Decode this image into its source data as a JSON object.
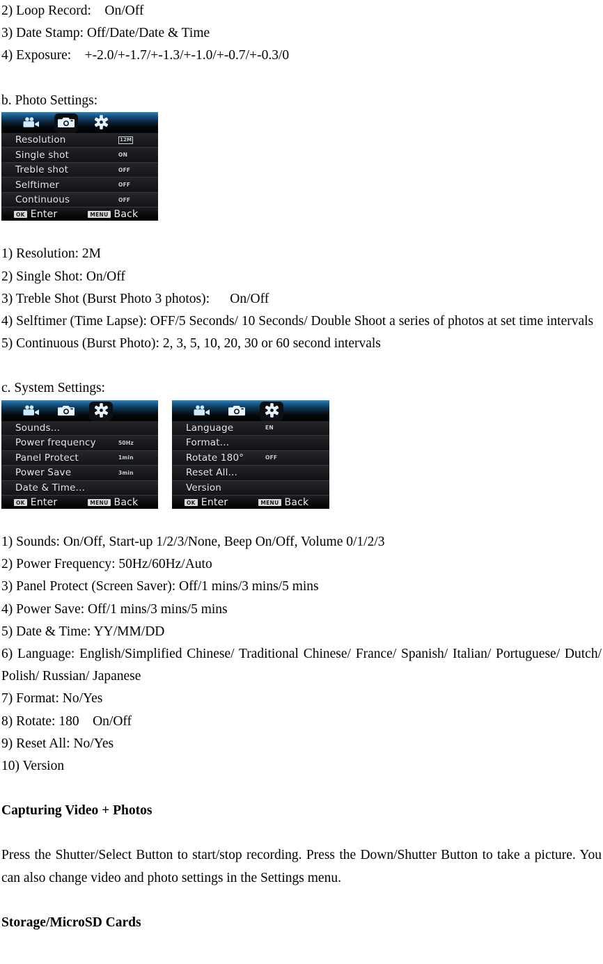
{
  "document": {
    "top_lines": [
      "2) Loop Record:    On/Off",
      "3) Date Stamp: Off/Date/Date & Time",
      "4) Exposure:    +-2.0/+-1.7/+-1.3/+-1.0/+-0.7/+-0.3/0"
    ],
    "photo_settings_heading": "b. Photo Settings:",
    "photo_settings_lines": [
      "1) Resolution: 2M",
      "2) Single Shot: On/Off",
      "3) Treble Shot (Burst Photo 3 photos):      On/Off",
      "4) Selftimer (Time Lapse): OFF/5 Seconds/ 10 Seconds/ Double Shoot a series of photos at set time intervals",
      "5) Continuous (Burst Photo): 2, 3, 5, 10, 20, 30 or 60 second intervals"
    ],
    "system_settings_heading": "c. System Settings:",
    "system_settings_lines": [
      "1) Sounds: On/Off, Start-up 1/2/3/None, Beep On/Off, Volume 0/1/2/3",
      "2) Power Frequency: 50Hz/60Hz/Auto",
      "3) Panel Protect (Screen Saver): Off/1 mins/3 mins/5 mins",
      "4) Power Save: Off/1 mins/3 mins/5 mins",
      "5) Date & Time: YY/MM/DD",
      "6) Language: English/Simplified Chinese/ Traditional Chinese/ France/ Spanish/ Italian/ Portuguese/ Dutch/ Polish/ Russian/ Japanese",
      "7) Format: No/Yes",
      "8) Rotate: 180    On/Off",
      "9) Reset All: No/Yes",
      "10) Version"
    ],
    "capturing_heading": "Capturing Video + Photos",
    "capturing_body": "Press the Shutter/Select Button to start/stop recording. Press the Down/Shutter Button to take a picture. You can also change video and photo settings in the Settings menu.",
    "storage_heading": "Storage/MicroSD Cards"
  },
  "osd_screens": {
    "photo": {
      "tabs": [
        {
          "icon": "video-camera-icon",
          "active": false
        },
        {
          "icon": "photo-camera-icon",
          "active": true
        },
        {
          "icon": "gear-icon",
          "active": false
        }
      ],
      "rows": [
        {
          "label": "Resolution",
          "value": "12M",
          "boxed": true
        },
        {
          "label": "Single shot",
          "value": "ON",
          "boxed": false
        },
        {
          "label": "Treble shot",
          "value": "OFF",
          "boxed": false
        },
        {
          "label": "Selftimer",
          "value": "OFF",
          "boxed": false
        },
        {
          "label": "Continuous",
          "value": "OFF",
          "boxed": false
        }
      ],
      "footer": {
        "ok_key": "OK",
        "ok_label": "Enter",
        "menu_key": "MENU",
        "menu_label": "Back"
      }
    },
    "system_a": {
      "tabs": [
        {
          "icon": "video-camera-icon",
          "active": false
        },
        {
          "icon": "photo-camera-icon",
          "active": false
        },
        {
          "icon": "gear-icon",
          "active": true
        }
      ],
      "rows": [
        {
          "label": "Sounds...",
          "value": "",
          "boxed": false
        },
        {
          "label": "Power frequency",
          "value": "50Hz",
          "boxed": false
        },
        {
          "label": "Panel Protect",
          "value": "1min",
          "boxed": false
        },
        {
          "label": "Power Save",
          "value": "3min",
          "boxed": false
        },
        {
          "label": "Date & Time...",
          "value": "",
          "boxed": false
        }
      ],
      "footer": {
        "ok_key": "OK",
        "ok_label": "Enter",
        "menu_key": "MENU",
        "menu_label": "Back"
      }
    },
    "system_b": {
      "tabs": [
        {
          "icon": "video-camera-icon",
          "active": false
        },
        {
          "icon": "photo-camera-icon",
          "active": false
        },
        {
          "icon": "gear-icon",
          "active": true
        }
      ],
      "rows": [
        {
          "label": "Language",
          "value": "EN",
          "boxed": false
        },
        {
          "label": "Format...",
          "value": "",
          "boxed": false
        },
        {
          "label": "Rotate 180°",
          "value": "OFF",
          "boxed": false
        },
        {
          "label": "Reset All...",
          "value": "",
          "boxed": false
        },
        {
          "label": "Version",
          "value": "",
          "boxed": false
        }
      ],
      "footer": {
        "ok_key": "OK",
        "ok_label": "Enter",
        "menu_key": "MENU",
        "menu_label": "Back"
      }
    }
  },
  "colors": {
    "tab_highlight": "#2f87c4",
    "osd_background": "#121316",
    "osd_text": "#e8eaec",
    "page_background": "#ffffff",
    "page_text": "#000000"
  }
}
